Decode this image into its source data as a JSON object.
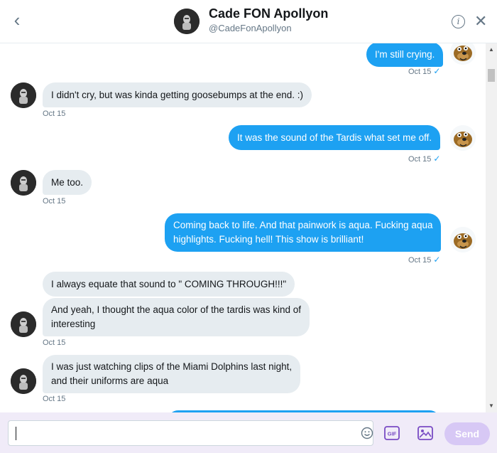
{
  "header": {
    "back_icon": "chevron-left-icon",
    "name": "Cade FON Apollyon",
    "handle": "@CadeFonApollyon",
    "info_icon": "info-icon",
    "close_icon": "close-icon"
  },
  "messages": [
    {
      "direction": "out",
      "text": "I'm still crying.",
      "time": "Oct 15",
      "read": "✓"
    },
    {
      "direction": "in",
      "text": "I didn't cry, but was kinda getting goosebumps at the end. :)",
      "time": "Oct 15"
    },
    {
      "direction": "out",
      "text": "It was the sound of the Tardis what set me off.",
      "time": "Oct 15",
      "read": "✓"
    },
    {
      "direction": "in",
      "text": "Me too.",
      "time": "Oct 15"
    },
    {
      "direction": "out",
      "line1": "Coming back to life. And that painwork is aqua. Fucking aqua",
      "line2": "highlights. Fucking hell! This show is brilliant!",
      "time": "Oct 15",
      "read": "✓"
    },
    {
      "direction": "in",
      "text": "I always equate that sound to \" COMING THROUGH!!!\""
    },
    {
      "direction": "in",
      "line1": "And yeah, I thought the aqua color of the tardis was kind of",
      "line2": "interesting",
      "time": "Oct 15"
    },
    {
      "direction": "in",
      "line1": "I was just watching clips of the Miami Dolphins last night,",
      "line2": "and their uniforms are aqua",
      "time": "Oct 15"
    }
  ],
  "composer": {
    "placeholder": "",
    "value": "",
    "emoji_icon": "emoji-icon",
    "gif_label": "GIF",
    "media_icon": "image-icon",
    "send_label": "Send"
  },
  "colors": {
    "outgoing_bubble": "#1da1f2",
    "incoming_bubble": "#e6ecf0",
    "composer_bg": "#f0ebf8",
    "send_disabled": "#d7c8f5",
    "accent_purple": "#794bc4"
  }
}
